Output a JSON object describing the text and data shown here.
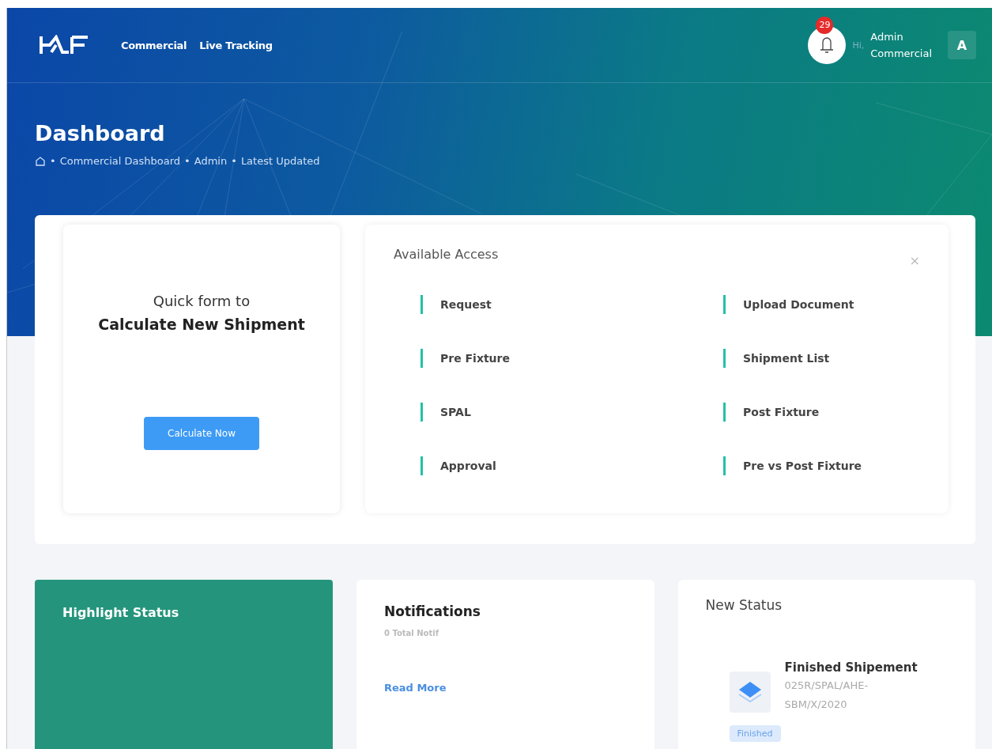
{
  "nav": {
    "links": [
      {
        "label": "Commercial"
      },
      {
        "label": "Live Tracking"
      }
    ],
    "notification_count": "29",
    "greeting": "Hi,",
    "user_name": "Admin",
    "user_role": "Commercial",
    "avatar": "A"
  },
  "page": {
    "title": "Dashboard",
    "breadcrumb_separator": "•",
    "breadcrumb": [
      "Commercial Dashboard",
      "Admin",
      "Latest Updated"
    ]
  },
  "quick_form": {
    "line1": "Quick form to",
    "line2": "Calculate New Shipment",
    "button": "Calculate Now"
  },
  "available_access": {
    "title": "Available Access",
    "close": "×",
    "items": [
      {
        "label": "Request"
      },
      {
        "label": "Upload Document"
      },
      {
        "label": "Pre Fixture"
      },
      {
        "label": "Shipment List"
      },
      {
        "label": "SPAL"
      },
      {
        "label": "Post Fixture"
      },
      {
        "label": "Approval"
      },
      {
        "label": "Pre vs Post Fixture"
      }
    ]
  },
  "highlight_status": {
    "title": "Highlight Status"
  },
  "notifications": {
    "title": "Notifications",
    "count": "0 Total Notif",
    "link": "Read More"
  },
  "new_status": {
    "title": "New Status",
    "item": {
      "title": "Finished Shipement",
      "code": "025R/SPAL/AHE-SBM/X/2020",
      "badge": "Finished"
    }
  }
}
